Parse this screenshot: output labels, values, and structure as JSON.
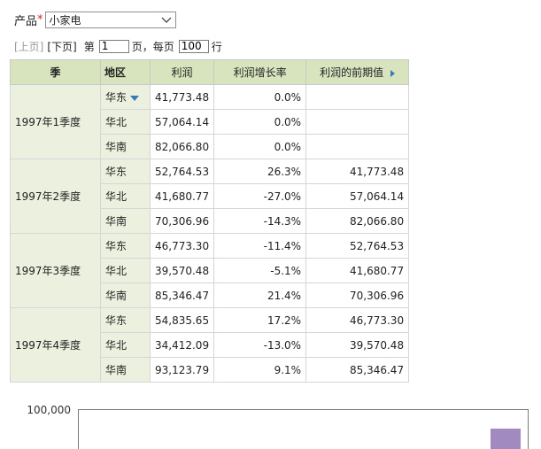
{
  "filter": {
    "label": "产品",
    "required_mark": "*",
    "value": "小家电"
  },
  "pager": {
    "prev_label": "[上页]",
    "next_label": "[下页]",
    "page_prefix": "第",
    "page_value": "1",
    "page_suffix": "页，每页",
    "size_value": "100",
    "size_suffix": "行"
  },
  "table": {
    "headers": {
      "season": "季",
      "region": "地区",
      "profit": "利润",
      "growth": "利润增长率",
      "prev": "利润的前期值"
    },
    "groups": [
      {
        "season": "1997年1季度",
        "rows": [
          {
            "region": "华东",
            "profit": "41,773.48",
            "growth": "0.0%",
            "prev": ""
          },
          {
            "region": "华北",
            "profit": "57,064.14",
            "growth": "0.0%",
            "prev": ""
          },
          {
            "region": "华南",
            "profit": "82,066.80",
            "growth": "0.0%",
            "prev": ""
          }
        ]
      },
      {
        "season": "1997年2季度",
        "rows": [
          {
            "region": "华东",
            "profit": "52,764.53",
            "growth": "26.3%",
            "prev": "41,773.48"
          },
          {
            "region": "华北",
            "profit": "41,680.77",
            "growth": "-27.0%",
            "prev": "57,064.14"
          },
          {
            "region": "华南",
            "profit": "70,306.96",
            "growth": "-14.3%",
            "prev": "82,066.80"
          }
        ]
      },
      {
        "season": "1997年3季度",
        "rows": [
          {
            "region": "华东",
            "profit": "46,773.30",
            "growth": "-11.4%",
            "prev": "52,764.53"
          },
          {
            "region": "华北",
            "profit": "39,570.48",
            "growth": "-5.1%",
            "prev": "41,680.77"
          },
          {
            "region": "华南",
            "profit": "85,346.47",
            "growth": "21.4%",
            "prev": "70,306.96"
          }
        ]
      },
      {
        "season": "1997年4季度",
        "rows": [
          {
            "region": "华东",
            "profit": "54,835.65",
            "growth": "17.2%",
            "prev": "46,773.30"
          },
          {
            "region": "华北",
            "profit": "34,412.09",
            "growth": "-13.0%",
            "prev": "39,570.48"
          },
          {
            "region": "华南",
            "profit": "93,123.79",
            "growth": "9.1%",
            "prev": "85,346.47"
          }
        ]
      }
    ]
  },
  "chart_data": {
    "type": "bar",
    "tick_labels": [
      "100,000"
    ],
    "ylim": [
      0,
      100000
    ],
    "bar_color": "#a18ac0"
  },
  "colors": {
    "header_bg": "#d7e4bd",
    "row_header_bg": "#ebf1de",
    "sort_icon": "#3a78b8",
    "required": "#d81b1b"
  }
}
